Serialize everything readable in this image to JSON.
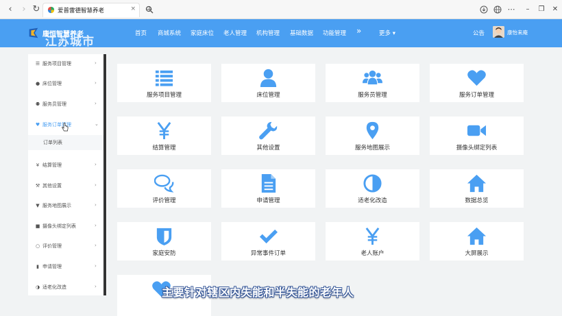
{
  "browser": {
    "tab_title": "爱普雷德智慧养老",
    "tab_close": "×",
    "new_tab": "+"
  },
  "header": {
    "brand": "康恒智慧养老",
    "watermark": "江苏城市",
    "nav": [
      "首页",
      "商城系统",
      "家庭床位",
      "老人管理",
      "机构管理",
      "基础数据",
      "功能管理"
    ],
    "more": "更多 ▾",
    "notice": "公告",
    "username": "康怡来庵",
    "accent_color": "#4a9ff2"
  },
  "sidebar": {
    "items": [
      {
        "label": "服务项目管理",
        "icon": "list-icon"
      },
      {
        "label": "床位管理",
        "icon": "user-icon"
      },
      {
        "label": "服务员管理",
        "icon": "group-icon"
      },
      {
        "label": "服务订单管理",
        "icon": "heart-icon",
        "active": true
      },
      {
        "label": "结算管理",
        "icon": "yen-icon"
      },
      {
        "label": "其他设置",
        "icon": "wrench-icon"
      },
      {
        "label": "服务地图展示",
        "icon": "map-pin-icon"
      },
      {
        "label": "摄像头绑定列表",
        "icon": "camera-icon"
      },
      {
        "label": "评价管理",
        "icon": "comment-icon"
      },
      {
        "label": "申请管理",
        "icon": "document-icon"
      },
      {
        "label": "适老化改造",
        "icon": "contrast-icon"
      }
    ],
    "sub_item": "订单列表"
  },
  "tiles": [
    {
      "label": "服务项目管理",
      "icon": "list-icon"
    },
    {
      "label": "床位管理",
      "icon": "user-icon"
    },
    {
      "label": "服务员管理",
      "icon": "group-icon"
    },
    {
      "label": "服务订单管理",
      "icon": "heart-icon"
    },
    {
      "label": "结算管理",
      "icon": "yen-icon"
    },
    {
      "label": "其他设置",
      "icon": "wrench-icon"
    },
    {
      "label": "服务地图展示",
      "icon": "map-pin-icon"
    },
    {
      "label": "摄像头绑定列表",
      "icon": "camera-icon"
    },
    {
      "label": "评价管理",
      "icon": "comment-icon"
    },
    {
      "label": "申请管理",
      "icon": "document-icon"
    },
    {
      "label": "适老化改造",
      "icon": "contrast-icon"
    },
    {
      "label": "数据总览",
      "icon": "home-icon"
    },
    {
      "label": "家庭安防",
      "icon": "shield-icon"
    },
    {
      "label": "异常事件订单",
      "icon": "check-icon"
    },
    {
      "label": "老人账户",
      "icon": "yen-icon"
    },
    {
      "label": "大屏展示",
      "icon": "home-icon"
    }
  ],
  "caption": "主要针对辖区内失能和半失能的老年人"
}
